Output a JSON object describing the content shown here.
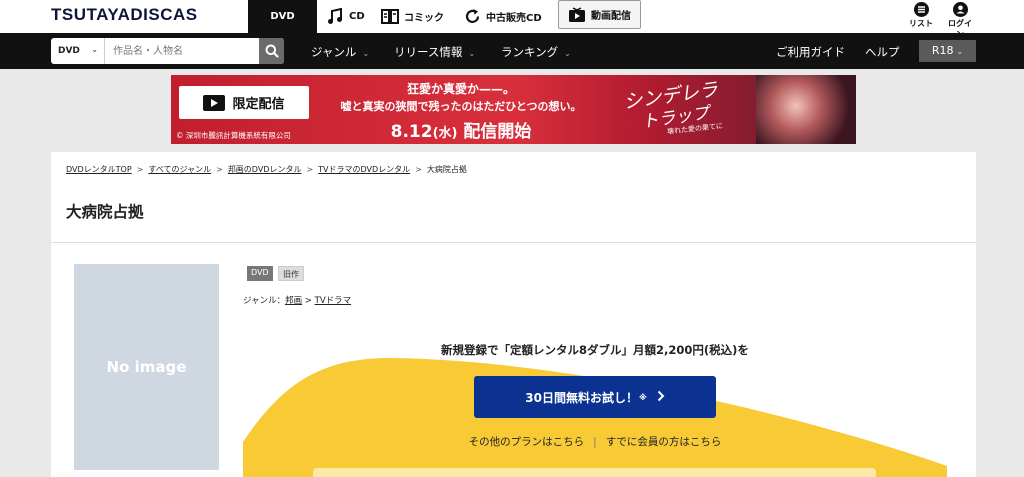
{
  "header": {
    "logo": "TSUTAYADISCAS",
    "services": [
      {
        "label": "DVD",
        "icon": "dvd"
      },
      {
        "label": "CD",
        "icon": "music-note-icon"
      },
      {
        "label": "コミック",
        "icon": "book-icon"
      },
      {
        "label": "中古販売CD",
        "icon": "recycle-icon"
      },
      {
        "label": "動画配信",
        "icon": "play-icon"
      }
    ],
    "utility": [
      {
        "label": "リスト",
        "icon": "list-icon"
      },
      {
        "label": "ログイン",
        "icon": "user-icon"
      }
    ]
  },
  "nav": {
    "search_category": "DVD",
    "search_placeholder": "作品名・人物名",
    "menu": [
      "ジャンル",
      "リリース情報",
      "ランキング"
    ],
    "guide": "ご利用ガイド",
    "help": "ヘルプ",
    "r18": "R18"
  },
  "banner": {
    "badge": "限定配信",
    "line1": "狂愛か真愛か——。",
    "line2": "嘘と真実の狭間で残ったのはただひとつの想い。",
    "date": "8.12",
    "weekday": "(水)",
    "release": "配信開始",
    "title1": "シンデレラ",
    "title2": "トラップ",
    "subtitle": "壊れた愛の果てに",
    "copyright": "© 深圳市騰訊計算機系統有限公司"
  },
  "breadcrumb": [
    "DVDレンタルTOP",
    "すべてのジャンル",
    "邦画のDVDレンタル",
    "TVドラマのDVDレンタル",
    "大病院占拠"
  ],
  "product": {
    "title": "大病院占拠",
    "no_image": "No image",
    "tags": [
      "DVD",
      "旧作"
    ],
    "genre_label": "ジャンル：",
    "genres": [
      "邦画",
      "TVドラマ"
    ]
  },
  "promo": {
    "message": "新規登録で「定額レンタル8ダブル」月額2,200円(税込)を",
    "cta": "30日間無料お試し！",
    "cta_mark": "※",
    "other_plans": "その他のプランはこちら",
    "members": "すでに会員の方はこちら"
  },
  "colors": {
    "accent_yellow": "#f8cb36",
    "cta_blue": "#0b3191",
    "nav_bg": "#111111"
  }
}
